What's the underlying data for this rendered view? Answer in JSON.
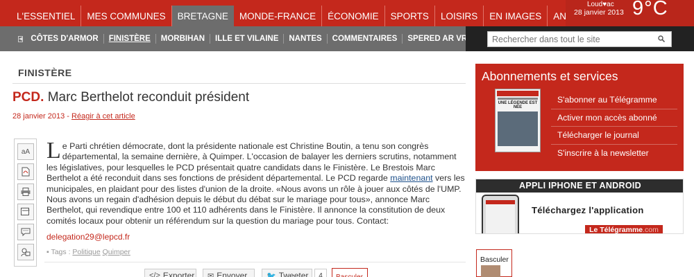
{
  "top_nav": {
    "items": [
      "L'ESSENTIEL",
      "MES COMMUNES",
      "BRETAGNE",
      "MONDE-FRANCE",
      "ÉCONOMIE",
      "SPORTS",
      "LOISIRS",
      "EN IMAGES",
      "ANNONCES"
    ],
    "active": "BRETAGNE"
  },
  "weather": {
    "location": "Loud♥ac",
    "date": "28 janvier 2013",
    "temperature": "9°C"
  },
  "sub_nav": {
    "items": [
      "CÔTES D'ARMOR",
      "FINISTÈRE",
      "MORBIHAN",
      "ILLE ET VILAINE",
      "NANTES",
      "COMMENTAIRES",
      "SPERED AR VRO",
      "V"
    ],
    "active": "FINISTÈRE"
  },
  "search": {
    "placeholder": "Rechercher dans tout le site"
  },
  "article": {
    "section": "FINISTÈRE",
    "prefix": "PCD.",
    "title": "Marc Berthelot reconduit président",
    "date": "28 janvier 2013 -",
    "react_link": "Réagir à cet article",
    "dropcap": "L",
    "body_part1": "e Parti chrétien démocrate, dont la présidente nationale est Christine Boutin, a tenu son congrès départemental, la semaine dernière, à Quimper. L'occasion de balayer les derniers scrutins, notamment les législatives, pour lesquelles le PCD présentait quatre candidats dans le Finistère. Le Brestois Marc Berthelot a été reconduit dans ses fonctions de président départemental. Le PCD regarde ",
    "body_link": "maintenant",
    "body_part2": " vers les municipales, en plaidant pour des listes d'union de la droite. «Nous avons un rôle à jouer aux côtés de l'UMP. Nous avons un regain d'adhésion depuis le début du débat sur le mariage pour tous», annonce Marc Berthelot, qui revendique entre 100 et 110 adhérents dans le Finistère. Il annonce la constitution de deux comités locaux pour obtenir un référendum sur la question du mariage pour tous. Contact:",
    "email": "delegation29@lepcd.fr",
    "tags_label": "Tags :",
    "tags": [
      "Politique",
      "Quimper"
    ]
  },
  "tools": {
    "font_size": "aA",
    "icons": [
      "font-size-icon",
      "pdf-icon",
      "print-icon",
      "bookmark-icon",
      "comment-icon",
      "email-icon"
    ]
  },
  "share": {
    "export": "Exporter",
    "send": "Envoyer",
    "tweet": "Tweeter",
    "tweet_count": "4",
    "basculer": "Basculer"
  },
  "sidebar": {
    "abonnements": {
      "title": "Abonnements et services",
      "links": [
        "S'abonner au Télégramme",
        "Activer mon accès abonné",
        "Télécharger le journal",
        "S'inscrire à la newsletter"
      ],
      "paper_headline": "UNE LÉGENDE EST NÉE"
    },
    "appli": {
      "header": "APPLI IPHONE ET ANDROID",
      "text": "Téléchargez l'application",
      "brand": "Le Télégramme",
      "brand_suffix": ".com"
    },
    "basculer": "Basculer"
  },
  "colors": {
    "brand_red": "#c4281c",
    "nav_gray": "#6d6d6d",
    "dark": "#222222"
  }
}
